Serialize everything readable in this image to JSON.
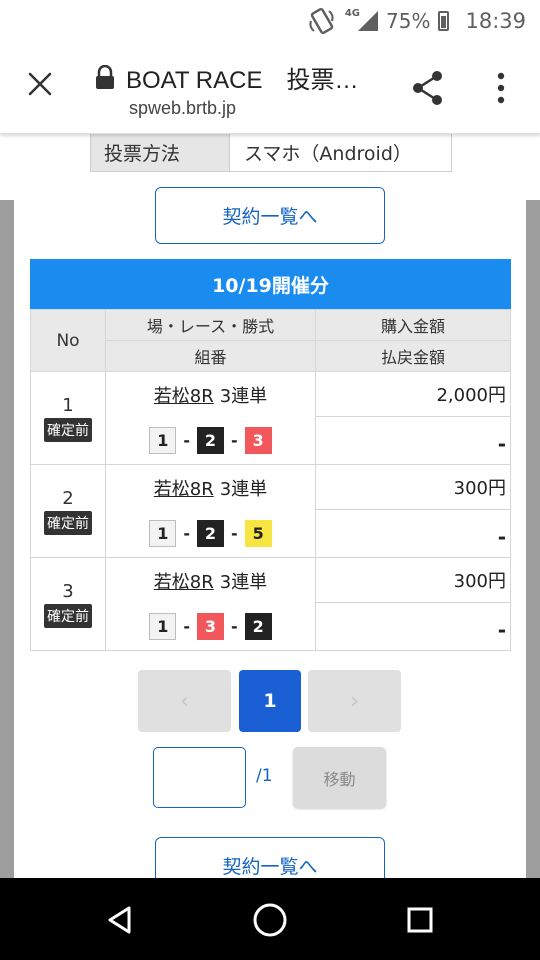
{
  "status_bar": {
    "network": "4G",
    "battery": "75%",
    "time": "18:39",
    "icons": [
      "vibrate-icon",
      "signal-icon",
      "battery-icon"
    ]
  },
  "browser": {
    "title": "BOAT RACE　投票…",
    "url": "spweb.brtb.jp",
    "icons": [
      "close-icon",
      "lock-icon",
      "share-icon",
      "more-vert-icon"
    ]
  },
  "method": {
    "label": "投票方法",
    "value": "スマホ（Android）"
  },
  "top_button": "契約一覧へ",
  "date_header": "10/19開催分",
  "table": {
    "headers": {
      "no": "No",
      "race": "場・レース・勝式",
      "combo": "組番",
      "purchase": "購入金額",
      "refund": "払戻金額"
    },
    "rows": [
      {
        "no": "1",
        "status": "確定前",
        "venue": "若松8R",
        "bet_type": "3連単",
        "combo": [
          "1",
          "2",
          "3"
        ],
        "combo_colors": [
          "white",
          "black",
          "red"
        ],
        "amount": "2,000円",
        "refund": "-"
      },
      {
        "no": "2",
        "status": "確定前",
        "venue": "若松8R",
        "bet_type": "3連単",
        "combo": [
          "1",
          "2",
          "5"
        ],
        "combo_colors": [
          "white",
          "black",
          "yellow"
        ],
        "amount": "300円",
        "refund": "-"
      },
      {
        "no": "3",
        "status": "確定前",
        "venue": "若松8R",
        "bet_type": "3連単",
        "combo": [
          "1",
          "3",
          "2"
        ],
        "combo_colors": [
          "white",
          "red",
          "black"
        ],
        "amount": "300円",
        "refund": "-"
      }
    ],
    "combo_separator": "-"
  },
  "pagination": {
    "prev": "‹",
    "current": "1",
    "next": "›",
    "input_value": "",
    "total": "/1",
    "move_label": "移動"
  },
  "bottom_button": "契約一覧へ",
  "colors": {
    "accent_blue": "#1a8cf0",
    "active_page": "#1a5fd4",
    "box_white": "#f3f3f3",
    "box_black": "#222222",
    "box_red": "#f2585b",
    "box_yellow": "#f7e541"
  },
  "navbar": {
    "icons": [
      "back-icon",
      "home-icon",
      "recents-icon"
    ]
  }
}
